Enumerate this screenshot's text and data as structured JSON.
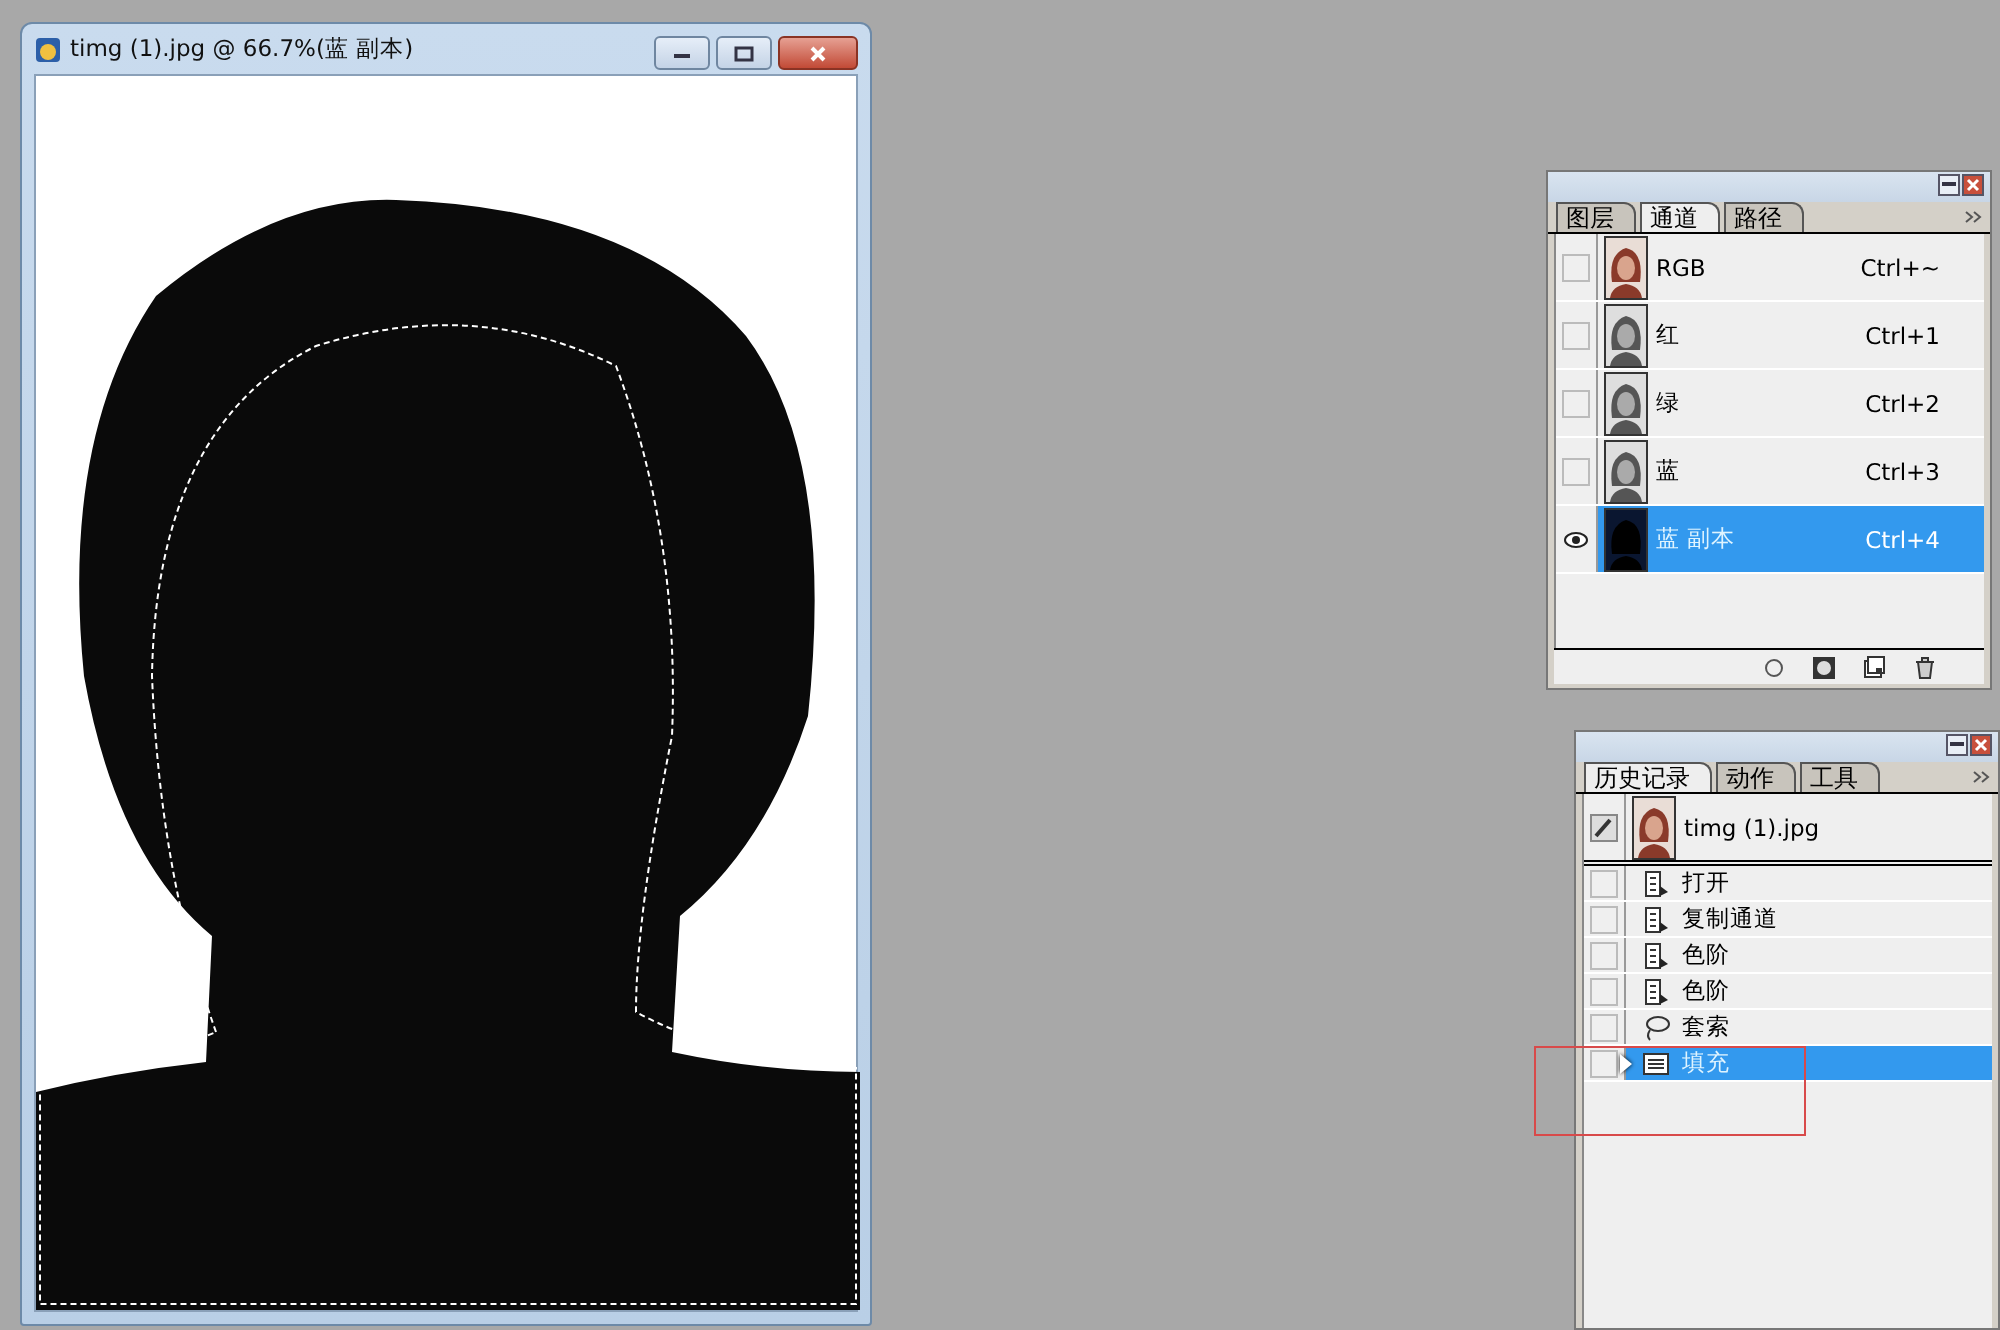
{
  "document": {
    "title": "timg (1).jpg @ 66.7%(蓝 副本)"
  },
  "channels_panel": {
    "tabs": [
      {
        "label": "图层",
        "selected": false
      },
      {
        "label": "通道",
        "selected": true
      },
      {
        "label": "路径",
        "selected": false
      }
    ],
    "channels": [
      {
        "name": "RGB",
        "shortcut": "Ctrl+~",
        "visible": false,
        "selected": false,
        "kind": "color"
      },
      {
        "name": "红",
        "shortcut": "Ctrl+1",
        "visible": false,
        "selected": false,
        "kind": "gray"
      },
      {
        "name": "绿",
        "shortcut": "Ctrl+2",
        "visible": false,
        "selected": false,
        "kind": "gray"
      },
      {
        "name": "蓝",
        "shortcut": "Ctrl+3",
        "visible": false,
        "selected": false,
        "kind": "gray"
      },
      {
        "name": "蓝 副本",
        "shortcut": "Ctrl+4",
        "visible": true,
        "selected": true,
        "kind": "mask"
      }
    ]
  },
  "history_panel": {
    "tabs": [
      {
        "label": "历史记录",
        "selected": true
      },
      {
        "label": "动作",
        "selected": false
      },
      {
        "label": "工具",
        "selected": false
      }
    ],
    "snapshot": {
      "name": "timg (1).jpg"
    },
    "steps": [
      {
        "label": "打开",
        "kind": "document",
        "selected": false
      },
      {
        "label": "复制通道",
        "kind": "document",
        "selected": false
      },
      {
        "label": "色阶",
        "kind": "document",
        "selected": false
      },
      {
        "label": "色阶",
        "kind": "document",
        "selected": false
      },
      {
        "label": "套索",
        "kind": "lasso",
        "selected": false
      },
      {
        "label": "填充",
        "kind": "fill",
        "selected": true
      }
    ]
  }
}
